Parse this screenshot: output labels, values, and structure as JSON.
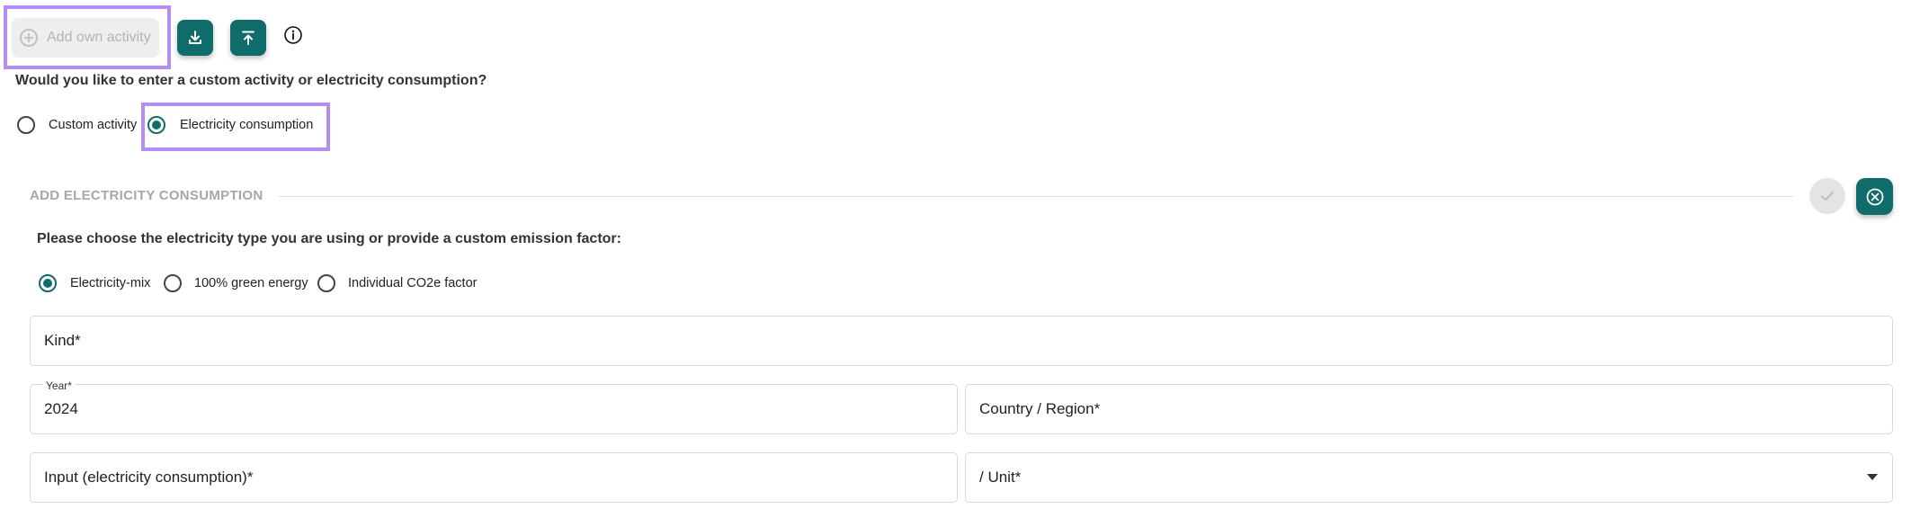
{
  "toolbar": {
    "add_own_activity_label": "Add own activity",
    "download_icon": "download-icon",
    "upload_icon": "upload-icon",
    "info_icon": "info-icon"
  },
  "custom_entry": {
    "question": "Would you like to enter a custom activity or electricity consumption?",
    "options": [
      {
        "label": "Custom activity",
        "selected": false
      },
      {
        "label": "Electricity consumption",
        "selected": true
      }
    ]
  },
  "electricity_section": {
    "title": "ADD ELECTRICITY CONSUMPTION",
    "prompt": "Please choose the electricity type you are using or provide a custom emission factor:",
    "types": [
      {
        "label": "Electricity-mix",
        "selected": true
      },
      {
        "label": "100% green energy",
        "selected": false
      },
      {
        "label": "Individual CO2e factor",
        "selected": false
      }
    ],
    "fields": {
      "kind": {
        "placeholder": "Kind*",
        "value": ""
      },
      "year": {
        "label": "Year*",
        "value": "2024"
      },
      "country_region": {
        "placeholder": "Country / Region*",
        "value": ""
      },
      "input": {
        "placeholder": "Input (electricity consumption)*",
        "value": ""
      },
      "unit": {
        "placeholder": "/ Unit*",
        "value": ""
      }
    }
  },
  "colors": {
    "accent": "#106b6b",
    "highlight": "#b58cf2",
    "disabled_bg": "#eeeeee",
    "disabled_text": "#b4b4b4"
  }
}
